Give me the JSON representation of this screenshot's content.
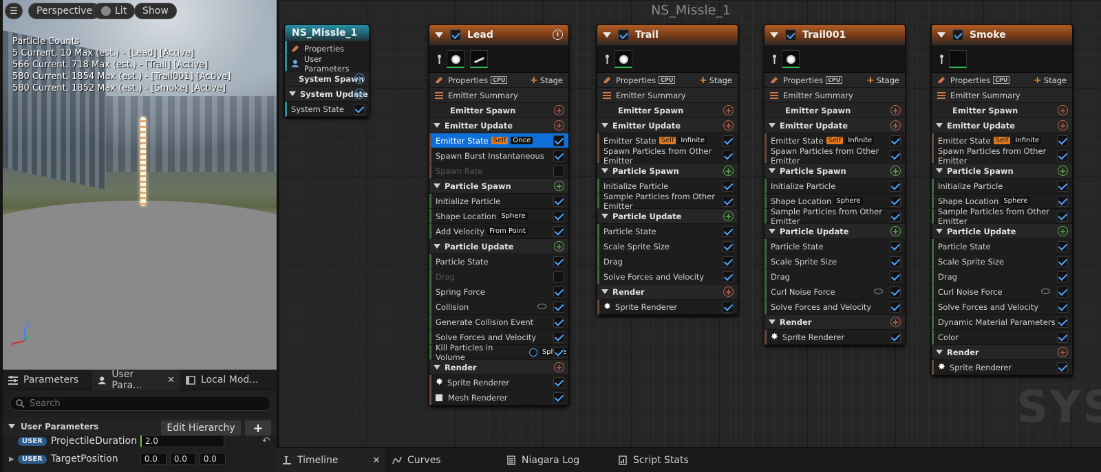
{
  "viewport": {
    "buttons": {
      "perspective": "Perspective",
      "lit": "Lit",
      "show": "Show"
    },
    "particle_counts_title": "Particle Counts",
    "particle_counts": [
      "5 Current, 10 Max (est.) - [Lead] [Active]",
      "566 Current, 718 Max (est.) - [Trail] [Active]",
      "580 Current, 1854 Max (est.) - [Trail001] [Active]",
      "580 Current, 1852 Max (est.) - [Smoke] [Active]"
    ],
    "axis": {
      "z": "Z"
    }
  },
  "left_tabs": [
    {
      "label": "Parameters",
      "icon": "parameters-icon"
    },
    {
      "label": "User Para...",
      "icon": "user-icon"
    },
    {
      "label": "Local Mod...",
      "icon": "local-module-icon"
    }
  ],
  "left_panel": {
    "search_placeholder": "Search",
    "section_title": "User Parameters",
    "edit_hierarchy": "Edit Hierarchy",
    "add_label": "+",
    "params": [
      {
        "tag": "USER",
        "name": "ProjectileDuration",
        "values": [
          "2.0"
        ]
      },
      {
        "tag": "USER",
        "name": "TargetPosition",
        "values": [
          "0.0",
          "0.0",
          "0.0"
        ]
      }
    ]
  },
  "graph": {
    "title": "NS_Missle_1",
    "watermark": "SYS",
    "system_node": {
      "title": "NS_Missle_1",
      "rows": [
        {
          "label": "Properties"
        },
        {
          "label": "User Parameters"
        },
        {
          "label": "System Spawn"
        },
        {
          "label": "System Update"
        },
        {
          "label": "System State"
        }
      ]
    },
    "common": {
      "properties": "Properties",
      "cpu": "CPU",
      "stage": "Stage",
      "emitter_summary": "Emitter Summary",
      "emitter_spawn": "Emitter Spawn",
      "emitter_update": "Emitter Update",
      "particle_spawn": "Particle Spawn",
      "particle_update": "Particle Update",
      "render": "Render",
      "self_tag": "Self"
    },
    "emitters": [
      {
        "title": "Lead",
        "emitter_state_mode": "Once",
        "emitter_update_items": [
          "Spawn Burst Instantaneous",
          "Spawn Rate"
        ],
        "spawn_items": [
          {
            "label": "Initialize Particle"
          },
          {
            "label": "Shape Location",
            "tag": "Sphere"
          },
          {
            "label": "Add Velocity",
            "tag": "From Point"
          }
        ],
        "update_items": [
          {
            "label": "Particle State"
          },
          {
            "label": "Drag"
          },
          {
            "label": "Spring Force"
          },
          {
            "label": "Collision"
          },
          {
            "label": "Generate Collision Event"
          },
          {
            "label": "Solve Forces and Velocity"
          },
          {
            "label": "Kill Particles in Volume",
            "tag": "Sphere"
          }
        ],
        "render_items": [
          "Sprite Renderer",
          "Mesh Renderer"
        ]
      },
      {
        "title": "Trail",
        "emitter_state_mode": "Infinite",
        "emitter_update_items": [
          "Spawn Particles from Other Emitter"
        ],
        "spawn_items": [
          {
            "label": "Initialize Particle"
          },
          {
            "label": "Sample Particles from Other Emitter"
          }
        ],
        "update_items": [
          {
            "label": "Particle State"
          },
          {
            "label": "Scale Sprite Size"
          },
          {
            "label": "Drag"
          },
          {
            "label": "Solve Forces and Velocity"
          }
        ],
        "render_items": [
          "Sprite Renderer"
        ]
      },
      {
        "title": "Trail001",
        "emitter_state_mode": "Infinite",
        "emitter_update_items": [
          "Spawn Particles from Other Emitter"
        ],
        "spawn_items": [
          {
            "label": "Initialize Particle"
          },
          {
            "label": "Shape Location",
            "tag": "Sphere"
          },
          {
            "label": "Sample Particles from Other Emitter"
          }
        ],
        "update_items": [
          {
            "label": "Particle State"
          },
          {
            "label": "Scale Sprite Size"
          },
          {
            "label": "Drag"
          },
          {
            "label": "Curl Noise Force"
          },
          {
            "label": "Solve Forces and Velocity"
          }
        ],
        "render_items": [
          "Sprite Renderer"
        ]
      },
      {
        "title": "Smoke",
        "emitter_state_mode": "Infinite",
        "emitter_update_items": [
          "Spawn Particles from Other Emitter"
        ],
        "spawn_items": [
          {
            "label": "Initialize Particle"
          },
          {
            "label": "Shape Location",
            "tag": "Sphere"
          },
          {
            "label": "Sample Particles from Other Emitter"
          }
        ],
        "update_items": [
          {
            "label": "Particle State"
          },
          {
            "label": "Scale Sprite Size"
          },
          {
            "label": "Drag"
          },
          {
            "label": "Curl Noise Force"
          },
          {
            "label": "Solve Forces and Velocity"
          },
          {
            "label": "Dynamic Material Parameters"
          },
          {
            "label": "Color"
          }
        ],
        "render_items": [
          "Sprite Renderer"
        ]
      }
    ]
  },
  "bottom_tabs": [
    {
      "label": "Timeline",
      "icon": "timeline-icon"
    },
    {
      "label": "Curves",
      "icon": "curves-icon"
    },
    {
      "label": "Niagara Log",
      "icon": "log-icon"
    },
    {
      "label": "Script Stats",
      "icon": "stats-icon"
    }
  ],
  "colors": {
    "accent": "#0e6fd8",
    "emitter_header": "#b35d25",
    "system_header": "#2a8fa4",
    "self_tag": "#e1781d"
  }
}
